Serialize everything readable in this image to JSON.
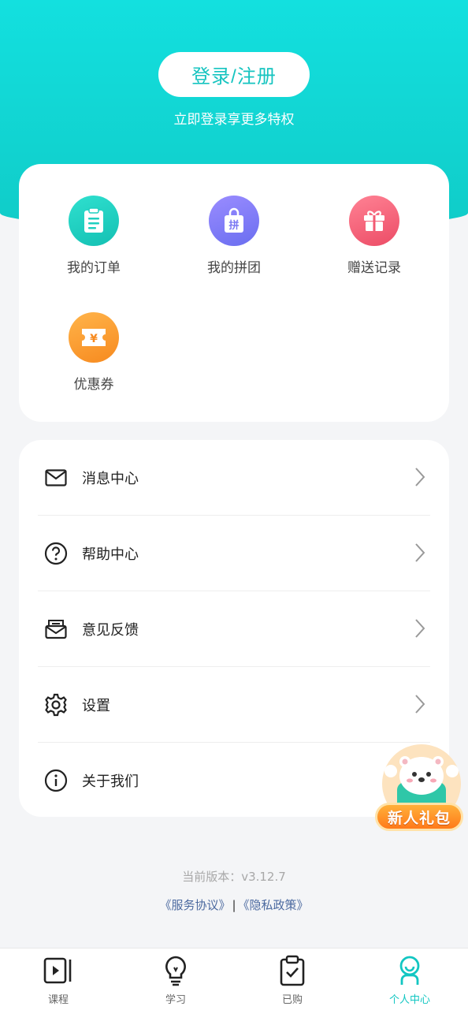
{
  "header": {
    "login_label": "登录/注册",
    "tip": "立即登录享更多特权"
  },
  "quick_grid": [
    {
      "label": "我的订单",
      "icon": "order-clipboard-icon",
      "color": "#1fcfbf"
    },
    {
      "label": "我的拼团",
      "icon": "group-buy-bag-icon",
      "color": "#7b78f3"
    },
    {
      "label": "赠送记录",
      "icon": "gift-box-icon",
      "color": "#f25a72"
    },
    {
      "label": "优惠券",
      "icon": "coupon-ticket-icon",
      "color": "#fb9a2e"
    }
  ],
  "menu": [
    {
      "label": "消息中心",
      "icon": "mail-icon"
    },
    {
      "label": "帮助中心",
      "icon": "help-circle-icon"
    },
    {
      "label": "意见反馈",
      "icon": "feedback-envelope-icon"
    },
    {
      "label": "设置",
      "icon": "gear-icon"
    },
    {
      "label": "关于我们",
      "icon": "info-circle-icon"
    }
  ],
  "footer": {
    "version": "当前版本：v3.12.7",
    "service_link": "《服务协议》",
    "separator": "|",
    "privacy_link": "《隐私政策》"
  },
  "promo": {
    "label": "新人礼包"
  },
  "tabbar": [
    {
      "label": "课程",
      "icon": "video-course-icon"
    },
    {
      "label": "学习",
      "icon": "lightbulb-icon"
    },
    {
      "label": "已购",
      "icon": "purchased-clipboard-icon"
    },
    {
      "label": "个人中心",
      "icon": "person-icon",
      "active": true
    }
  ],
  "colors": {
    "brand": "#12c6c2",
    "link": "#4c6aa0"
  }
}
